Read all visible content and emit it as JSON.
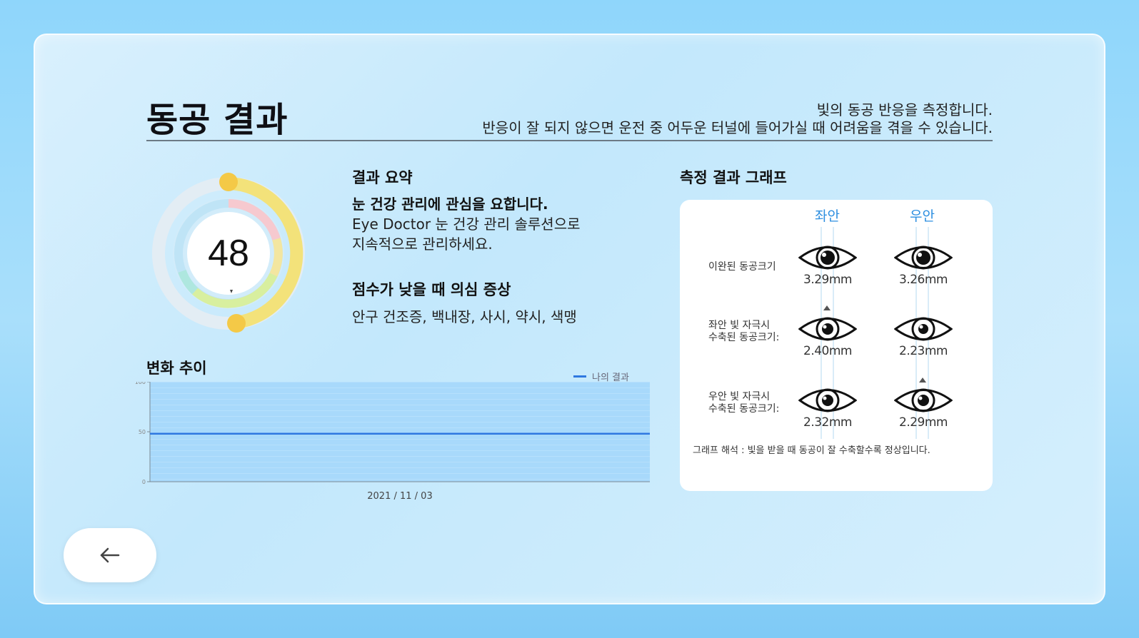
{
  "header": {
    "title": "동공 결과",
    "description_line1": "빛의 동공 반응을 측정합니다.",
    "description_line2": "반응이 잘 되지 않으면 운전 중 어두운 터널에 들어가실 때 어려움을 겪을 수 있습니다."
  },
  "gauge": {
    "score": "48"
  },
  "summary": {
    "heading": "결과 요약",
    "headline": "눈 건강 관리에 관심을 요합니다.",
    "body_line1": "Eye Doctor 눈 건강 관리 솔루션으로",
    "body_line2": "지속적으로 관리하세요."
  },
  "symptoms": {
    "heading": "점수가 낮을 때 의심 증상",
    "list": "안구 건조증, 백내장, 사시, 약시, 색맹"
  },
  "trend": {
    "heading": "변화 추이",
    "legend": "나의 결과",
    "y_ticks": [
      "100",
      "50",
      "0"
    ],
    "date": "2021 / 11 / 03"
  },
  "chart_data": {
    "type": "line",
    "x": [
      "2021 / 11 / 03"
    ],
    "series": [
      {
        "name": "나의 결과",
        "values": [
          48
        ]
      }
    ],
    "ylim": [
      0,
      100
    ],
    "yticks": [
      0,
      50,
      100
    ]
  },
  "graph": {
    "heading": "측정 결과 그래프",
    "left_label": "좌안",
    "right_label": "우안",
    "rows": [
      {
        "label_line1": "이완된 동공크기",
        "label_line2": "",
        "left": "3.29mm",
        "right": "3.26mm"
      },
      {
        "label_line1": "좌안 빛 자극시",
        "label_line2": "수축된 동공크기:",
        "left": "2.40mm",
        "right": "2.23mm"
      },
      {
        "label_line1": "우안 빛 자극시",
        "label_line2": "수축된 동공크기:",
        "left": "2.32mm",
        "right": "2.29mm"
      }
    ],
    "note": "그래프 해석 : 빛을 받을 때 동공이 잘 수축할수록 정상입니다."
  },
  "colors": {
    "accent_blue": "#2e8fe0",
    "gauge_yellow": "#f3e27a",
    "line_blue": "#2f78e0"
  },
  "icons": {
    "back": "arrow-left-icon",
    "eye": "eye-icon"
  }
}
